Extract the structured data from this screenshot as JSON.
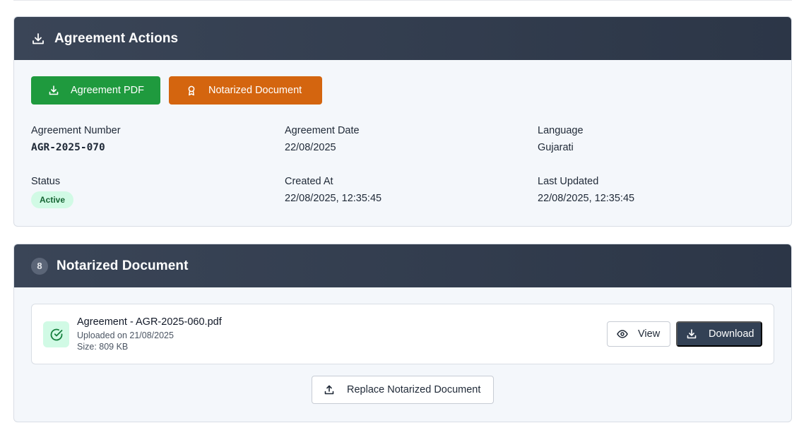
{
  "actions_card": {
    "title": "Agreement Actions",
    "header_icon": "download-icon",
    "buttons": {
      "agreement_pdf": "Agreement PDF",
      "notarized_document": "Notarized Document"
    },
    "fields": {
      "agreement_number_label": "Agreement Number",
      "agreement_number": "AGR-2025-070",
      "agreement_date_label": "Agreement Date",
      "agreement_date": "22/08/2025",
      "language_label": "Language",
      "language": "Gujarati",
      "status_label": "Status",
      "status": "Active",
      "created_at_label": "Created At",
      "created_at": "22/08/2025, 12:35:45",
      "last_updated_label": "Last Updated",
      "last_updated": "22/08/2025, 12:35:45"
    }
  },
  "notarized_card": {
    "step_number": "8",
    "title": "Notarized Document",
    "document": {
      "file_name": "Agreement - AGR-2025-060.pdf",
      "uploaded": "Uploaded on 21/08/2025",
      "size": "Size: 809 KB"
    },
    "view_label": "View",
    "download_label": "Download",
    "replace_label": "Replace Notarized Document"
  },
  "colors": {
    "header_bg": "#2f3a4c",
    "green_button": "#1f9a3e",
    "orange_button": "#d4650f",
    "active_badge_bg": "#d1fae5",
    "dark_button": "#334155"
  }
}
